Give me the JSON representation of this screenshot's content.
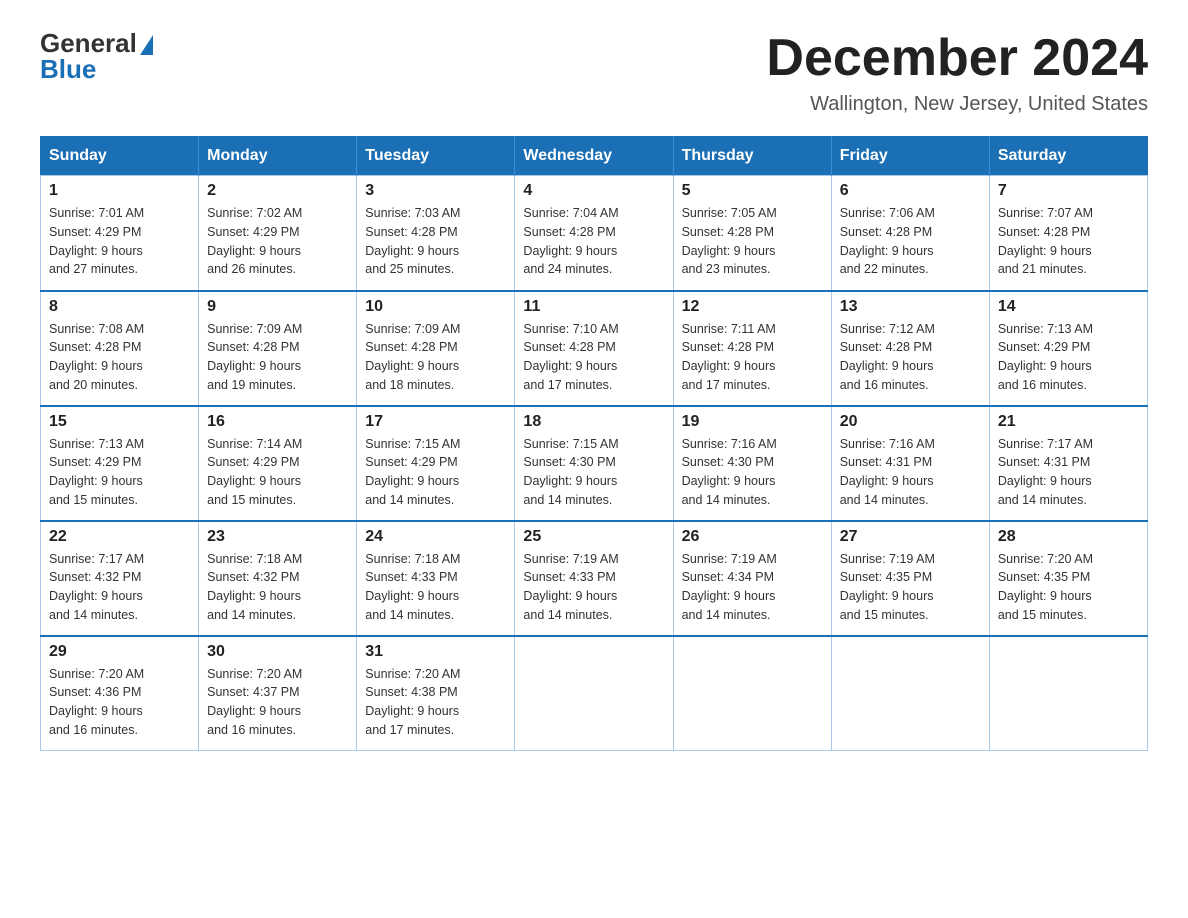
{
  "header": {
    "logo_general": "General",
    "logo_blue": "Blue",
    "title": "December 2024",
    "subtitle": "Wallington, New Jersey, United States"
  },
  "days_of_week": [
    "Sunday",
    "Monday",
    "Tuesday",
    "Wednesday",
    "Thursday",
    "Friday",
    "Saturday"
  ],
  "weeks": [
    [
      {
        "day": "1",
        "sunrise": "7:01 AM",
        "sunset": "4:29 PM",
        "daylight": "9 hours and 27 minutes."
      },
      {
        "day": "2",
        "sunrise": "7:02 AM",
        "sunset": "4:29 PM",
        "daylight": "9 hours and 26 minutes."
      },
      {
        "day": "3",
        "sunrise": "7:03 AM",
        "sunset": "4:28 PM",
        "daylight": "9 hours and 25 minutes."
      },
      {
        "day": "4",
        "sunrise": "7:04 AM",
        "sunset": "4:28 PM",
        "daylight": "9 hours and 24 minutes."
      },
      {
        "day": "5",
        "sunrise": "7:05 AM",
        "sunset": "4:28 PM",
        "daylight": "9 hours and 23 minutes."
      },
      {
        "day": "6",
        "sunrise": "7:06 AM",
        "sunset": "4:28 PM",
        "daylight": "9 hours and 22 minutes."
      },
      {
        "day": "7",
        "sunrise": "7:07 AM",
        "sunset": "4:28 PM",
        "daylight": "9 hours and 21 minutes."
      }
    ],
    [
      {
        "day": "8",
        "sunrise": "7:08 AM",
        "sunset": "4:28 PM",
        "daylight": "9 hours and 20 minutes."
      },
      {
        "day": "9",
        "sunrise": "7:09 AM",
        "sunset": "4:28 PM",
        "daylight": "9 hours and 19 minutes."
      },
      {
        "day": "10",
        "sunrise": "7:09 AM",
        "sunset": "4:28 PM",
        "daylight": "9 hours and 18 minutes."
      },
      {
        "day": "11",
        "sunrise": "7:10 AM",
        "sunset": "4:28 PM",
        "daylight": "9 hours and 17 minutes."
      },
      {
        "day": "12",
        "sunrise": "7:11 AM",
        "sunset": "4:28 PM",
        "daylight": "9 hours and 17 minutes."
      },
      {
        "day": "13",
        "sunrise": "7:12 AM",
        "sunset": "4:28 PM",
        "daylight": "9 hours and 16 minutes."
      },
      {
        "day": "14",
        "sunrise": "7:13 AM",
        "sunset": "4:29 PM",
        "daylight": "9 hours and 16 minutes."
      }
    ],
    [
      {
        "day": "15",
        "sunrise": "7:13 AM",
        "sunset": "4:29 PM",
        "daylight": "9 hours and 15 minutes."
      },
      {
        "day": "16",
        "sunrise": "7:14 AM",
        "sunset": "4:29 PM",
        "daylight": "9 hours and 15 minutes."
      },
      {
        "day": "17",
        "sunrise": "7:15 AM",
        "sunset": "4:29 PM",
        "daylight": "9 hours and 14 minutes."
      },
      {
        "day": "18",
        "sunrise": "7:15 AM",
        "sunset": "4:30 PM",
        "daylight": "9 hours and 14 minutes."
      },
      {
        "day": "19",
        "sunrise": "7:16 AM",
        "sunset": "4:30 PM",
        "daylight": "9 hours and 14 minutes."
      },
      {
        "day": "20",
        "sunrise": "7:16 AM",
        "sunset": "4:31 PM",
        "daylight": "9 hours and 14 minutes."
      },
      {
        "day": "21",
        "sunrise": "7:17 AM",
        "sunset": "4:31 PM",
        "daylight": "9 hours and 14 minutes."
      }
    ],
    [
      {
        "day": "22",
        "sunrise": "7:17 AM",
        "sunset": "4:32 PM",
        "daylight": "9 hours and 14 minutes."
      },
      {
        "day": "23",
        "sunrise": "7:18 AM",
        "sunset": "4:32 PM",
        "daylight": "9 hours and 14 minutes."
      },
      {
        "day": "24",
        "sunrise": "7:18 AM",
        "sunset": "4:33 PM",
        "daylight": "9 hours and 14 minutes."
      },
      {
        "day": "25",
        "sunrise": "7:19 AM",
        "sunset": "4:33 PM",
        "daylight": "9 hours and 14 minutes."
      },
      {
        "day": "26",
        "sunrise": "7:19 AM",
        "sunset": "4:34 PM",
        "daylight": "9 hours and 14 minutes."
      },
      {
        "day": "27",
        "sunrise": "7:19 AM",
        "sunset": "4:35 PM",
        "daylight": "9 hours and 15 minutes."
      },
      {
        "day": "28",
        "sunrise": "7:20 AM",
        "sunset": "4:35 PM",
        "daylight": "9 hours and 15 minutes."
      }
    ],
    [
      {
        "day": "29",
        "sunrise": "7:20 AM",
        "sunset": "4:36 PM",
        "daylight": "9 hours and 16 minutes."
      },
      {
        "day": "30",
        "sunrise": "7:20 AM",
        "sunset": "4:37 PM",
        "daylight": "9 hours and 16 minutes."
      },
      {
        "day": "31",
        "sunrise": "7:20 AM",
        "sunset": "4:38 PM",
        "daylight": "9 hours and 17 minutes."
      },
      null,
      null,
      null,
      null
    ]
  ],
  "labels": {
    "sunrise": "Sunrise:",
    "sunset": "Sunset:",
    "daylight": "Daylight:"
  }
}
